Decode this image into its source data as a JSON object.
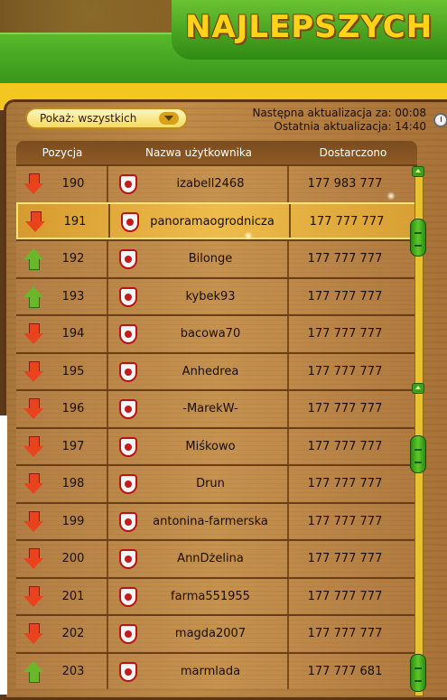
{
  "header": {
    "title": "NAJLEPSZYCH"
  },
  "filter": {
    "label": "Pokaż: wszystkich",
    "icon": "dropdown-arrow-icon"
  },
  "updates": {
    "next": "Następna aktualizacja za: 00:08",
    "last": "Ostatnia aktualizacja: 14:40"
  },
  "table": {
    "headers": {
      "position": "Pozycja",
      "username": "Nazwa użytkownika",
      "delivered": "Dostarczono"
    },
    "rows": [
      {
        "trend": "down",
        "position": "190",
        "username": "izabell2468",
        "delivered": "177 983 777"
      },
      {
        "trend": "down",
        "position": "191",
        "username": "panoramaogrodnicza",
        "delivered": "177 777 777",
        "highlighted": true
      },
      {
        "trend": "up",
        "position": "192",
        "username": "Bilonge",
        "delivered": "177 777 777"
      },
      {
        "trend": "up",
        "position": "193",
        "username": "kybek93",
        "delivered": "177 777 777"
      },
      {
        "trend": "down",
        "position": "194",
        "username": "bacowa70",
        "delivered": "177 777 777"
      },
      {
        "trend": "down",
        "position": "195",
        "username": "Anhedrea",
        "delivered": "177 777 777"
      },
      {
        "trend": "down",
        "position": "196",
        "username": "-MarekW-",
        "delivered": "177 777 777"
      },
      {
        "trend": "down",
        "position": "197",
        "username": "Miśkowo",
        "delivered": "177 777 777"
      },
      {
        "trend": "down",
        "position": "198",
        "username": "Drun",
        "delivered": "177 777 777"
      },
      {
        "trend": "down",
        "position": "199",
        "username": "antonina-farmerska",
        "delivered": "177 777 777"
      },
      {
        "trend": "down",
        "position": "200",
        "username": "AnnDżelina",
        "delivered": "177 777 777"
      },
      {
        "trend": "down",
        "position": "201",
        "username": "farma551955",
        "delivered": "177 777 777"
      },
      {
        "trend": "down",
        "position": "202",
        "username": "magda2007",
        "delivered": "177 777 777"
      },
      {
        "trend": "up",
        "position": "203",
        "username": "marmlada",
        "delivered": "177 777 681"
      }
    ]
  },
  "colors": {
    "accent_title": "#ffd31a",
    "up_arrow": "#6ab82a",
    "down_arrow": "#e8431c",
    "highlight_row": "#eebc4c"
  }
}
